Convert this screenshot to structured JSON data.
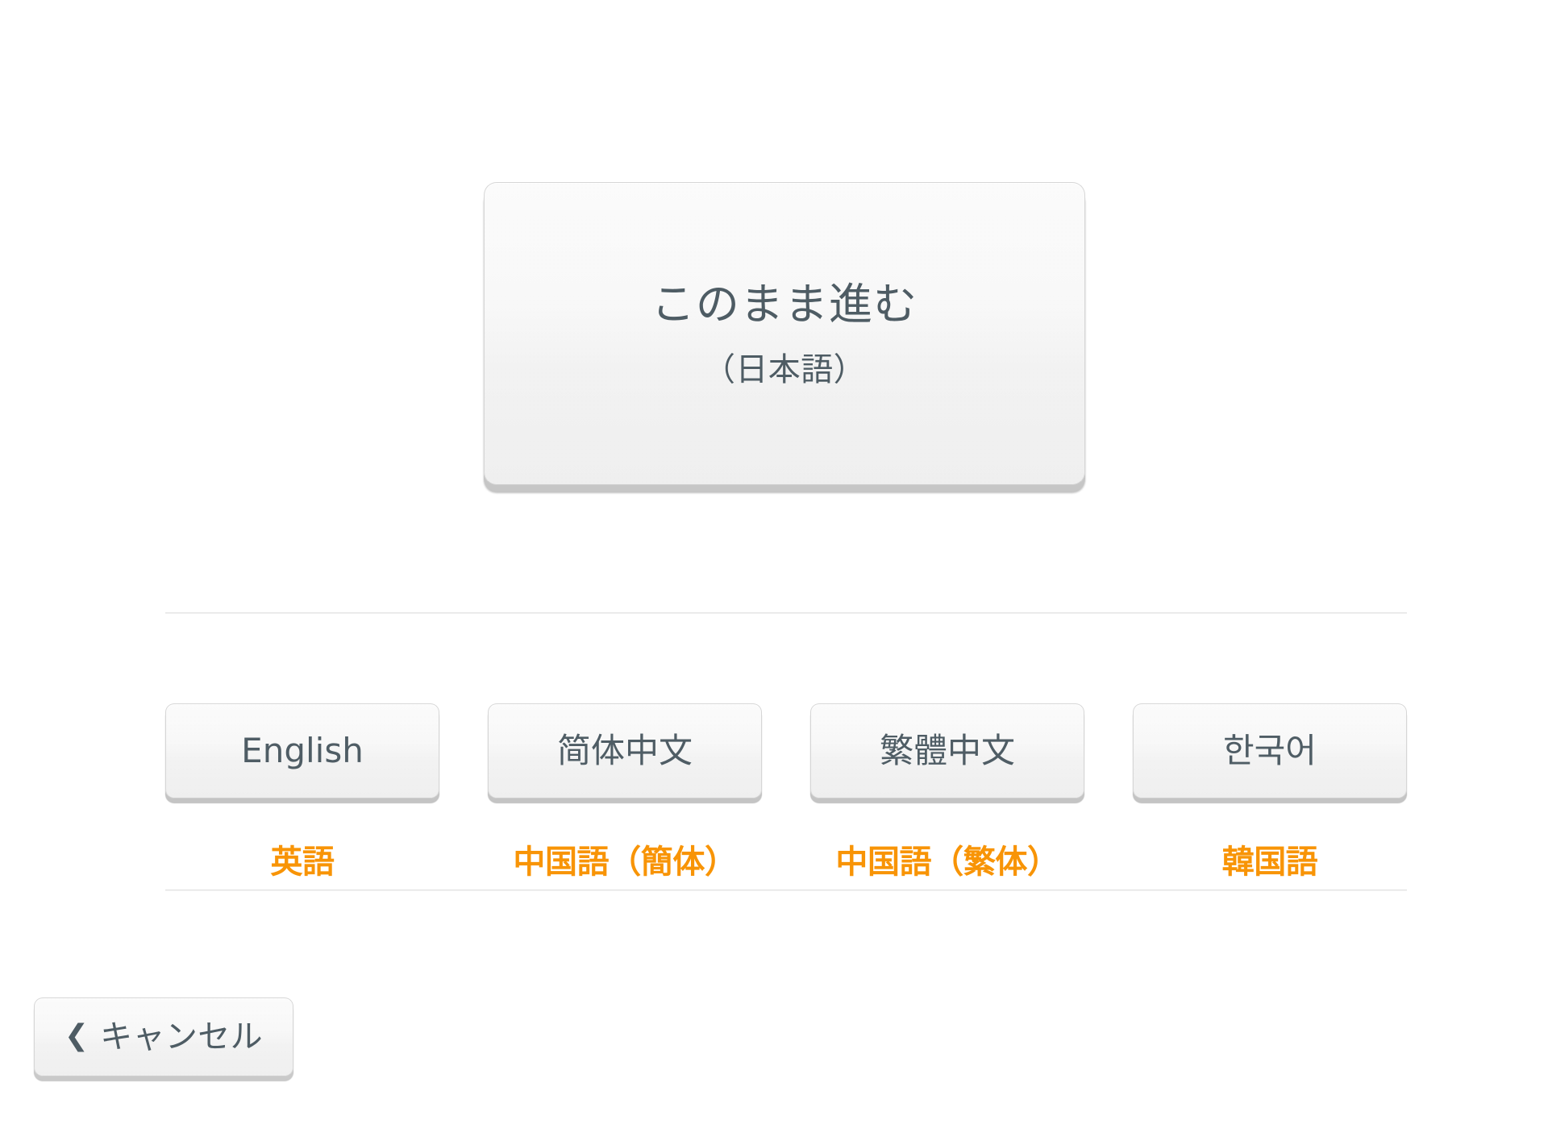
{
  "colors": {
    "accent_orange": "#f89406",
    "button_text": "#4e5c64",
    "button_face": "#f6f6f6",
    "button_ledge": "#c4c4c4",
    "divider": "#e3e3e3",
    "page_background": "#ffffff"
  },
  "continue": {
    "main_label": "このまま進む",
    "sub_label": "（日本語）"
  },
  "languages": [
    {
      "button_label": "English",
      "native_label": "英語"
    },
    {
      "button_label": "简体中文",
      "native_label": "中国語（簡体）"
    },
    {
      "button_label": "繁體中文",
      "native_label": "中国語（繁体）"
    },
    {
      "button_label": "한국어",
      "native_label": "韓国語"
    }
  ],
  "cancel": {
    "icon": "chevron-left-icon",
    "glyph": "❮",
    "label": "キャンセル"
  }
}
